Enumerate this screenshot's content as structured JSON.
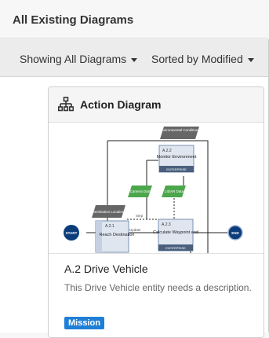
{
  "header": {
    "title": "All Existing Diagrams"
  },
  "toolbar": {
    "filter_label": "Showing All Diagrams",
    "sort_label": "Sorted by Modified"
  },
  "card": {
    "title": "Action Diagram",
    "name": "A.2 Drive Vehicle",
    "description": "This Drive Vehicle entity needs a description.",
    "badge": "Mission"
  },
  "diagram": {
    "start_label": "START",
    "end_label": "END",
    "env_conditions": "Environmental Conditions",
    "nodes": [
      {
        "id": "A.2.2",
        "label": "Monitor Environment",
        "tag": "ENTERPRISE"
      },
      {
        "id": "A.2.1",
        "label": "Reach Destination",
        "tag": "LOOP"
      },
      {
        "id": "A.2.3",
        "label": "Calculate Waypoint and",
        "tag": "ENTERPRISE"
      }
    ],
    "data_items": [
      "Camera Data",
      "LIDAR Data"
    ],
    "location_label": "Destination Location",
    "edge_labels": [
      "Update",
      "Step"
    ]
  }
}
